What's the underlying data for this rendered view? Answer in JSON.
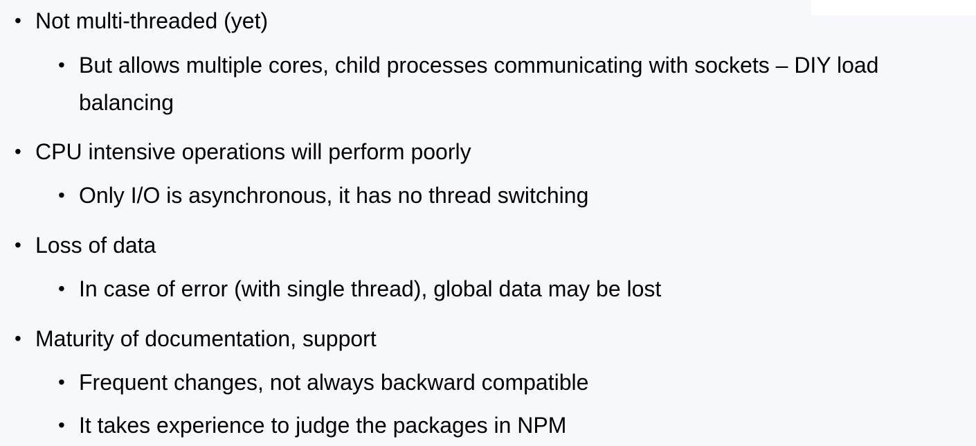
{
  "slide": {
    "items": [
      {
        "level": 1,
        "text": "Not multi-threaded (yet)"
      },
      {
        "level": 2,
        "text": "But allows multiple cores, child processes communicating with sockets – DIY load balancing"
      },
      {
        "level": 1,
        "text": "CPU intensive operations will perform poorly"
      },
      {
        "level": 2,
        "text": "Only I/O is asynchronous, it has no thread switching"
      },
      {
        "level": 1,
        "text": "Loss of data"
      },
      {
        "level": 2,
        "text": "In case of error (with single thread), global data may be lost"
      },
      {
        "level": 1,
        "text": "Maturity of documentation, support"
      },
      {
        "level": 2,
        "text": "Frequent changes, not always backward compatible"
      },
      {
        "level": 2,
        "text": "It takes experience to judge the packages in NPM"
      }
    ]
  }
}
